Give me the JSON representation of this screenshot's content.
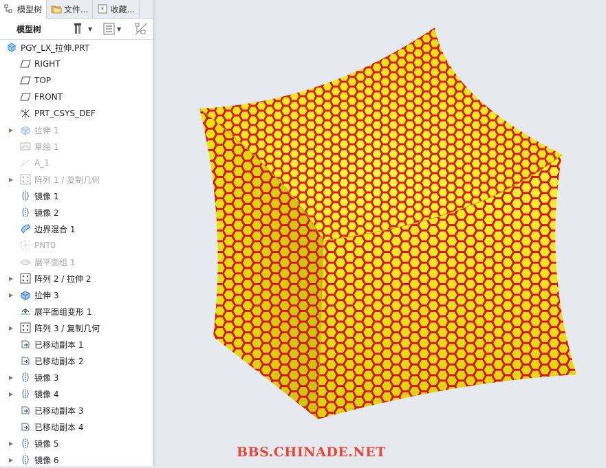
{
  "tabs": [
    {
      "label": "模型树"
    },
    {
      "label": "文件..."
    },
    {
      "label": "收藏..."
    }
  ],
  "toolbar": {
    "label": "模型树"
  },
  "tree": {
    "root": {
      "label": "PGY_LX_拉伸.PRT",
      "icon": "part-icon"
    },
    "items": [
      {
        "label": "RIGHT",
        "icon": "datum-plane-icon",
        "dim": false,
        "expandable": false
      },
      {
        "label": "TOP",
        "icon": "datum-plane-icon",
        "dim": false,
        "expandable": false
      },
      {
        "label": "FRONT",
        "icon": "datum-plane-icon",
        "dim": false,
        "expandable": false
      },
      {
        "label": "PRT_CSYS_DEF",
        "icon": "csys-icon",
        "dim": false,
        "expandable": false
      },
      {
        "label": "拉伸 1",
        "icon": "extrude-icon",
        "dim": true,
        "expandable": true
      },
      {
        "label": "草绘 1",
        "icon": "sketch-icon",
        "dim": true,
        "expandable": false
      },
      {
        "label": "A_1",
        "icon": "axis-icon",
        "dim": true,
        "expandable": false
      },
      {
        "label": "阵列 1 / 复制几何",
        "icon": "pattern-icon",
        "dim": true,
        "expandable": true
      },
      {
        "label": "镜像 1",
        "icon": "mirror-icon",
        "dim": false,
        "expandable": false
      },
      {
        "label": "镜像 2",
        "icon": "mirror-icon",
        "dim": false,
        "expandable": false
      },
      {
        "label": "边界混合 1",
        "icon": "boundary-blend-icon",
        "dim": false,
        "expandable": false
      },
      {
        "label": "PNT0",
        "icon": "datum-point-icon",
        "dim": true,
        "expandable": false
      },
      {
        "label": "展平面组 1",
        "icon": "flatten-quilt-icon",
        "dim": true,
        "expandable": false
      },
      {
        "label": "阵列 2 / 拉伸 2",
        "icon": "pattern-icon",
        "dim": false,
        "expandable": true
      },
      {
        "label": "拉伸 3",
        "icon": "extrude-icon",
        "dim": false,
        "expandable": true
      },
      {
        "label": "展平面组变形 1",
        "icon": "flatten-deform-icon",
        "dim": false,
        "expandable": false
      },
      {
        "label": "阵列 3 / 复制几何",
        "icon": "pattern-icon",
        "dim": false,
        "expandable": true
      },
      {
        "label": "已移动副本 1",
        "icon": "moved-copy-icon",
        "dim": false,
        "expandable": false
      },
      {
        "label": "已移动副本 2",
        "icon": "moved-copy-icon",
        "dim": false,
        "expandable": false
      },
      {
        "label": "镜像 3",
        "icon": "mirror-icon",
        "dim": false,
        "expandable": true
      },
      {
        "label": "镜像 4",
        "icon": "mirror-icon",
        "dim": false,
        "expandable": true
      },
      {
        "label": "已移动副本 3",
        "icon": "moved-copy-icon",
        "dim": false,
        "expandable": false
      },
      {
        "label": "已移动副本 4",
        "icon": "moved-copy-icon",
        "dim": false,
        "expandable": false
      },
      {
        "label": "镜像 5",
        "icon": "mirror-icon",
        "dim": false,
        "expandable": true
      },
      {
        "label": "镜像 6",
        "icon": "mirror-icon",
        "dim": false,
        "expandable": true
      }
    ]
  },
  "viewport": {
    "surface_color": "#f4ef12",
    "hex_color": "#d8131c",
    "background": "#e6e9ee"
  },
  "watermark": "BBS.CHINADE.NET"
}
